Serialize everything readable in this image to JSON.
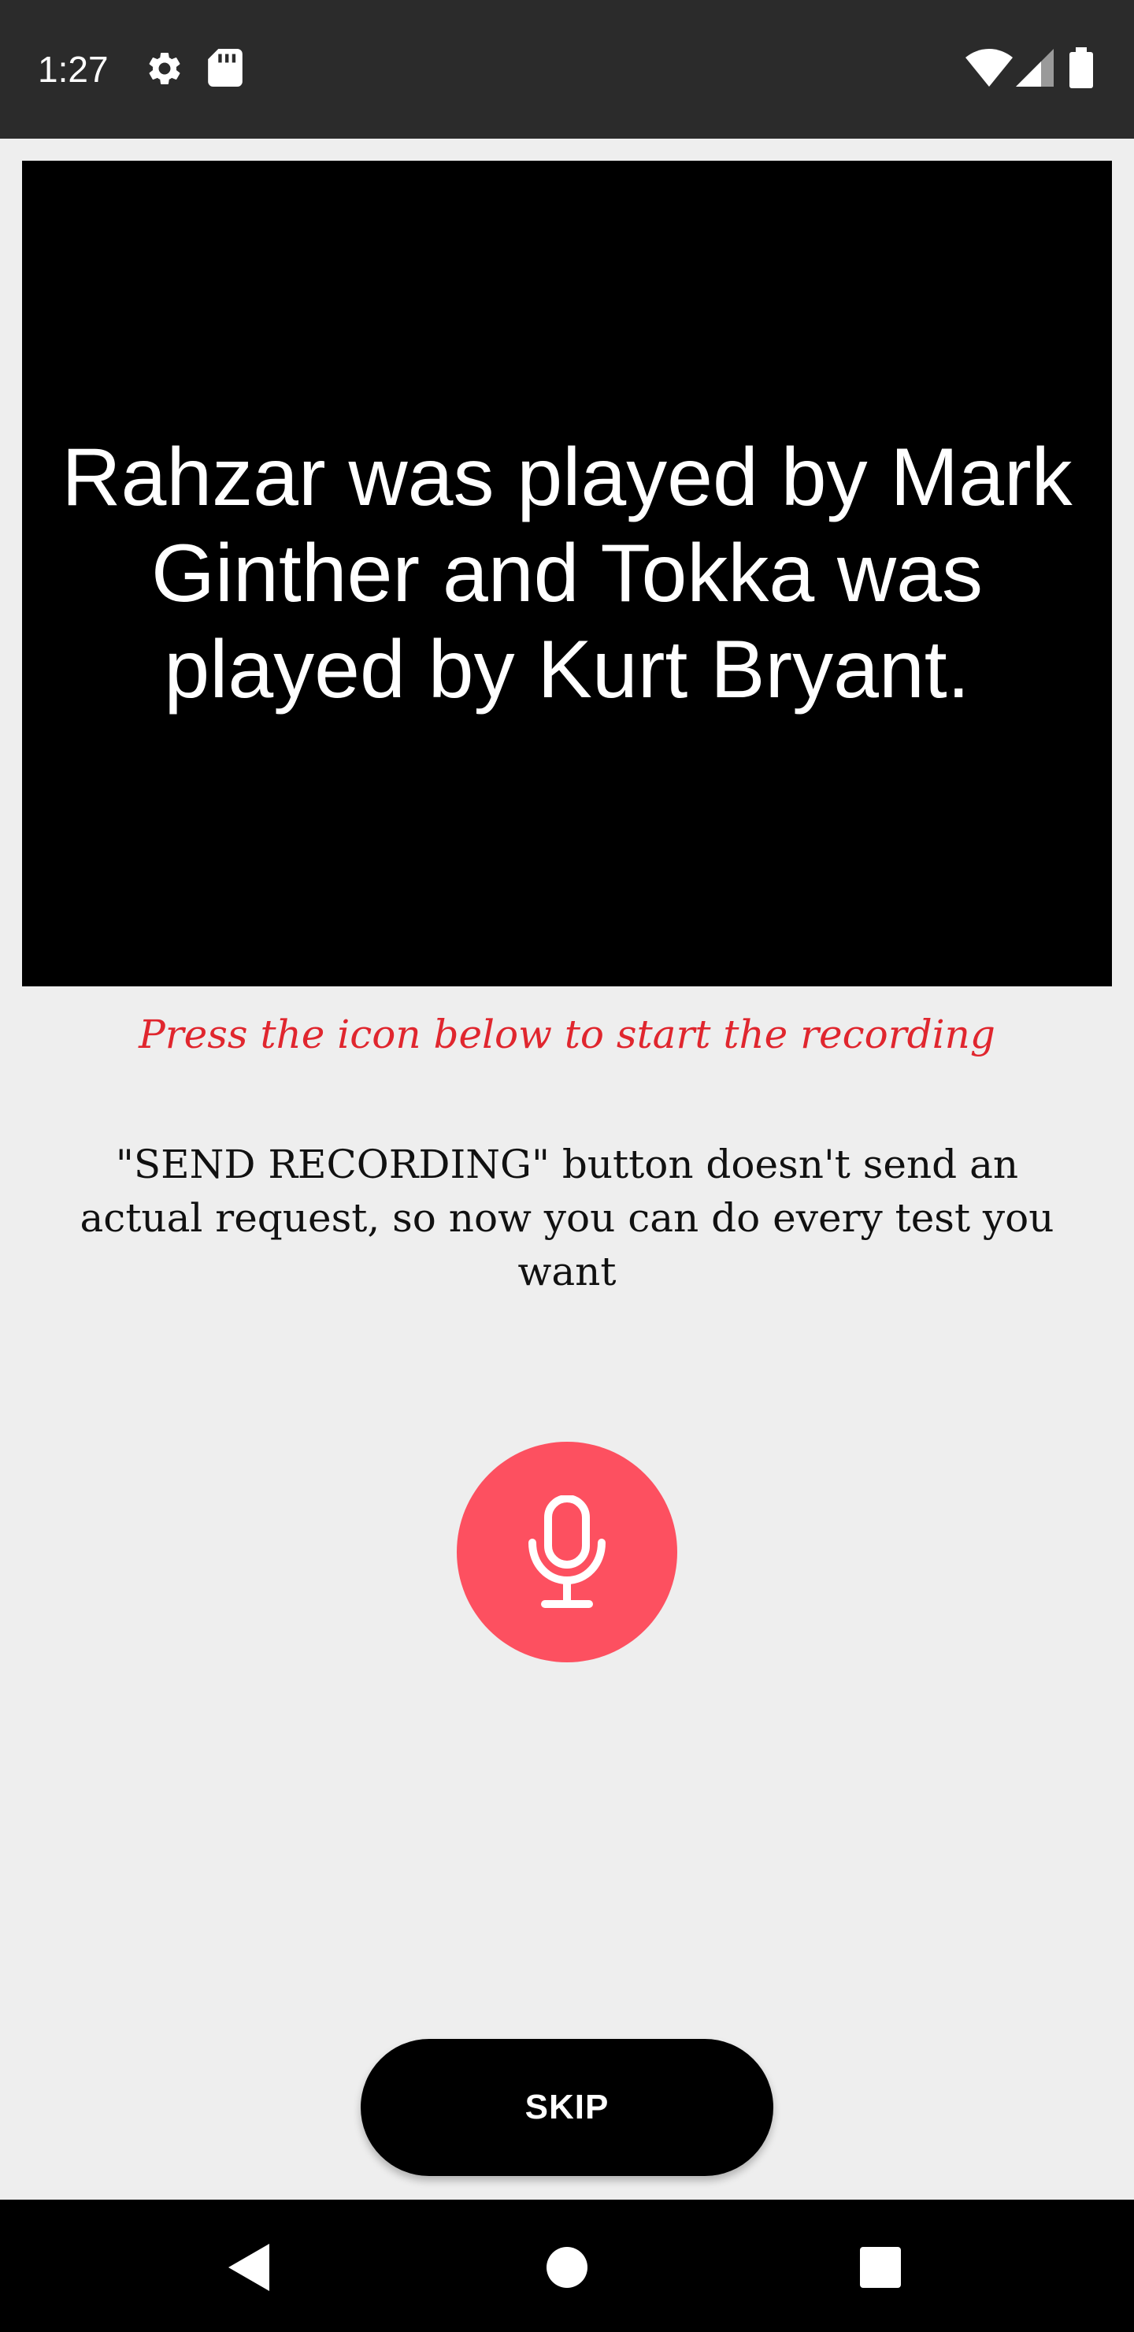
{
  "status_bar": {
    "time": "1:27",
    "icons": [
      "settings-icon",
      "sd-card-icon",
      "wifi-icon",
      "cellular-signal-icon",
      "battery-icon"
    ]
  },
  "card": {
    "text": "Rahzar was played by Mark Ginther and Tokka was played by Kurt Bryant."
  },
  "instruction": "Press the icon below to start the recording",
  "note": "\"SEND RECORDING\" button doesn't send an actual request, so now you can do every test you want",
  "mic_button": {
    "icon": "microphone-icon",
    "color": "#fd5060"
  },
  "skip_button": {
    "label": "SKIP"
  },
  "nav_bar": {
    "icons": [
      "back-icon",
      "home-icon",
      "recents-icon"
    ]
  },
  "colors": {
    "accent": "#fd5060",
    "instruction_text": "#e0262e",
    "status_bar_bg": "#2b2b2b",
    "background": "#eeeeee"
  }
}
